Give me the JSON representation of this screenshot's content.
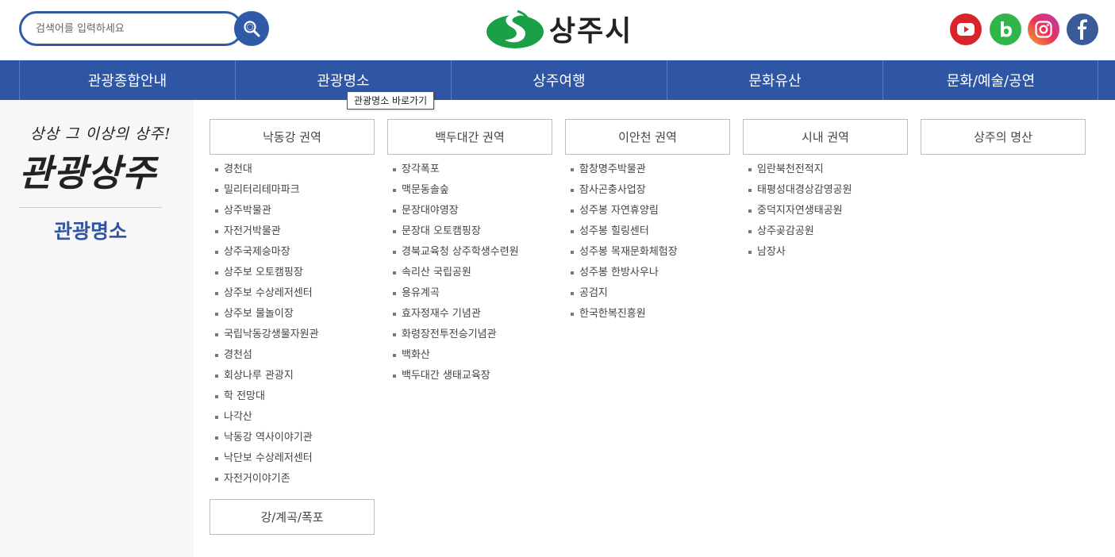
{
  "search": {
    "placeholder": "검색어를 입력하세요"
  },
  "logo": {
    "text": "상주시"
  },
  "social": [
    "youtube",
    "blog",
    "instagram",
    "facebook"
  ],
  "nav": {
    "items": [
      "관광종합안내",
      "관광명소",
      "상주여행",
      "문화유산",
      "문화/예술/공연"
    ],
    "tooltip": "관광명소 바로가기"
  },
  "side": {
    "slogan": "상상 그 이상의 상주!",
    "brand": "관광상주",
    "title": "관광명소"
  },
  "columns": [
    {
      "title": "낙동강 권역",
      "items": [
        "경천대",
        "밀리터리테마파크",
        "상주박물관",
        "자전거박물관",
        "상주국제승마장",
        "상주보 오토캠핑장",
        "상주보 수상레저센터",
        "상주보 물놀이장",
        "국립낙동강생물자원관",
        "경천섬",
        "회상나루 관광지",
        "학 전망대",
        "나각산",
        "낙동강 역사이야기관",
        "낙단보 수상레저센터",
        "자전거이야기존"
      ],
      "second_title": "강/계곡/폭포"
    },
    {
      "title": "백두대간 권역",
      "items": [
        "장각폭포",
        "맥문동솔숲",
        "문장대야영장",
        "문장대 오토캠핑장",
        "경북교육청 상주학생수련원",
        "속리산 국립공원",
        "용유계곡",
        "효자정재수 기념관",
        "화령장전투전승기념관",
        "백화산",
        "백두대간 생태교육장"
      ]
    },
    {
      "title": "이안천 권역",
      "items": [
        "함창명주박물관",
        "잠사곤충사업장",
        "성주봉 자연휴양림",
        "성주봉 힐링센터",
        "성주봉 목재문화체험장",
        "성주봉 한방사우나",
        "공검지",
        "한국한복진흥원"
      ]
    },
    {
      "title": "시내 권역",
      "items": [
        "임란북천전적지",
        "태평성대경상감영공원",
        "중덕지자연생태공원",
        "상주곶감공원",
        "남장사"
      ]
    },
    {
      "title": "상주의 명산",
      "items": []
    }
  ],
  "colors": {
    "primary": "#2f56a5",
    "logo_green": "#1aa046"
  }
}
